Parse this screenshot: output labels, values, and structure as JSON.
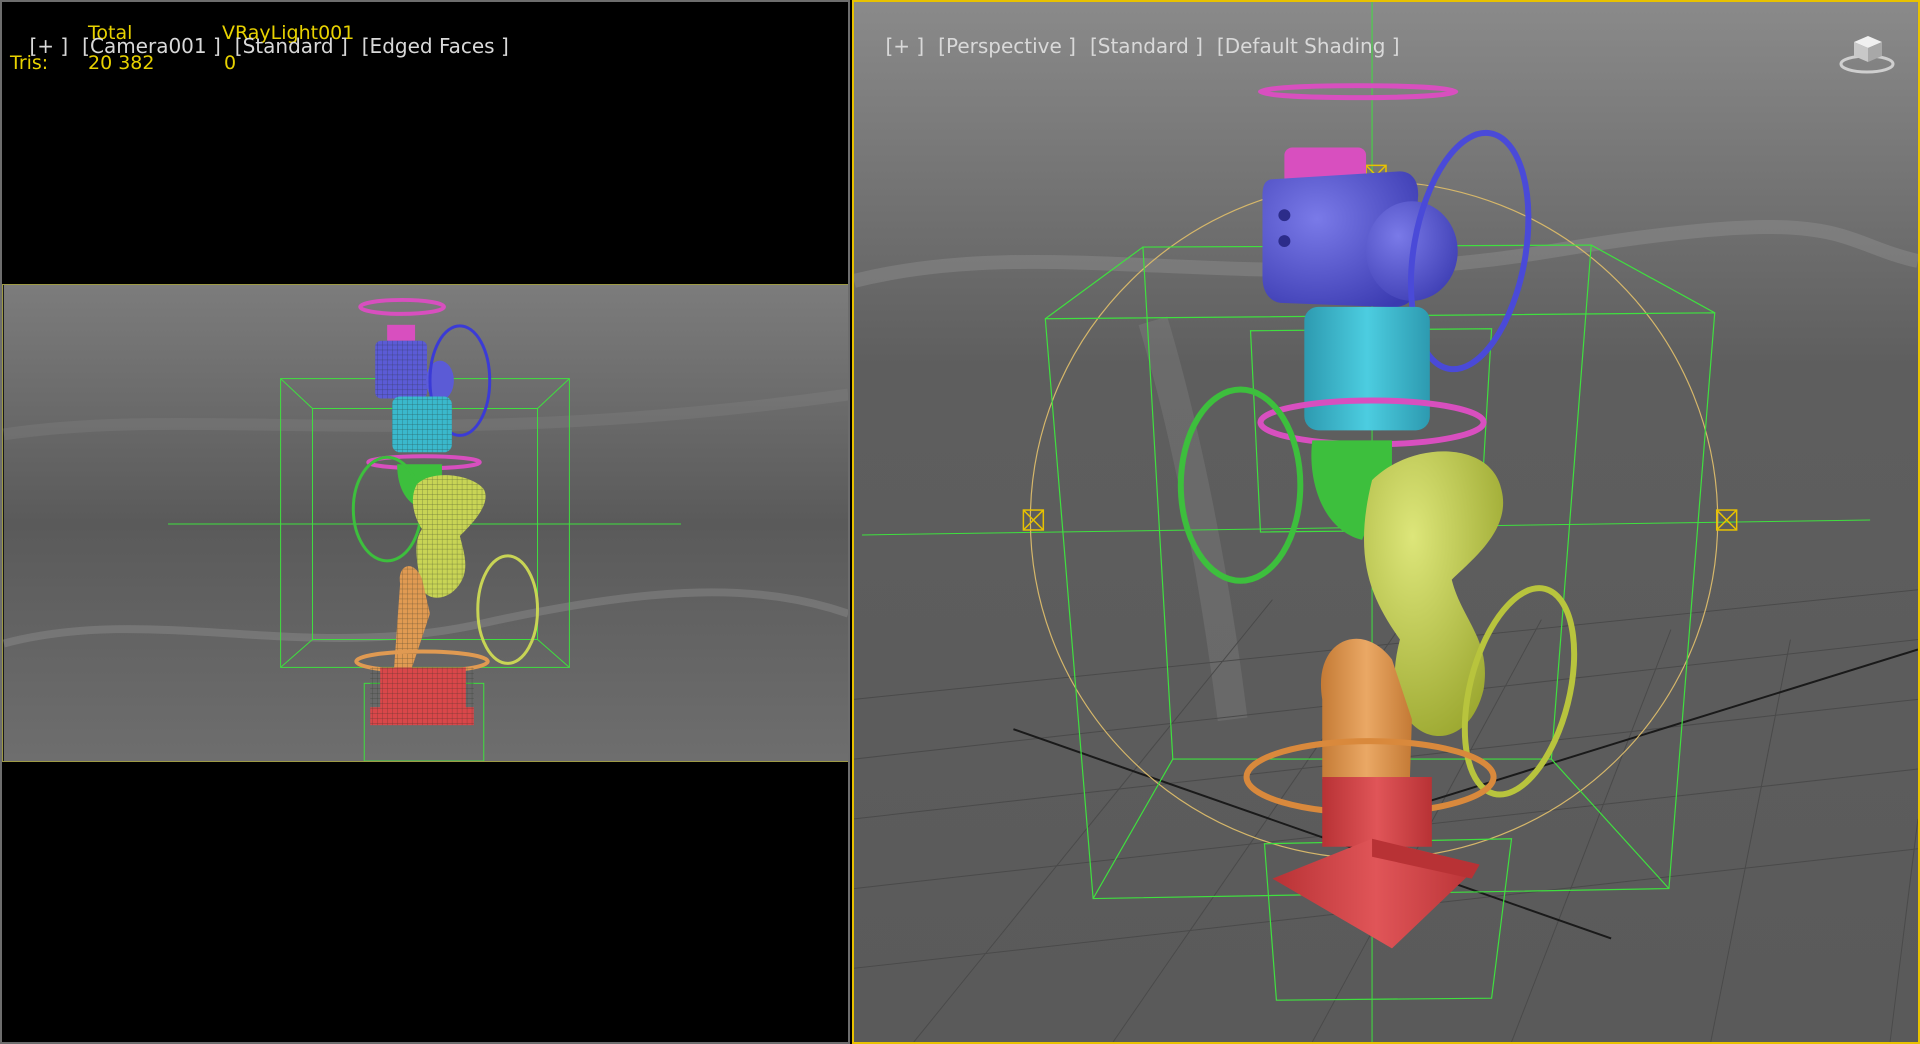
{
  "left_viewport": {
    "labels": [
      "[+ ]",
      "[Camera001 ]",
      "[Standard ]",
      "[Edged Faces ]"
    ],
    "stats": {
      "col_total": "Total",
      "col_light": "VRayLight001",
      "row_label": "Tris:",
      "total_value": "20 382",
      "light_value": "0"
    }
  },
  "right_viewport": {
    "labels": [
      "[+ ]",
      "[Perspective ]",
      "[Standard ]",
      "[Default Shading ]"
    ]
  },
  "colors": {
    "stats_text": "#e8d200",
    "active_border": "#e8c200",
    "selection_box": "#3fe03f",
    "base_red": "#d9474a",
    "lower_arm_orange": "#e09a52",
    "upper_arm_yellow": "#c8d455",
    "elbow_green": "#3dbf3d",
    "cylinder_cyan": "#3ab8cc",
    "head_blue": "#5b5bd6",
    "cap_pink": "#d84fbf"
  },
  "icons": {
    "viewcube": "viewcube-icon"
  }
}
